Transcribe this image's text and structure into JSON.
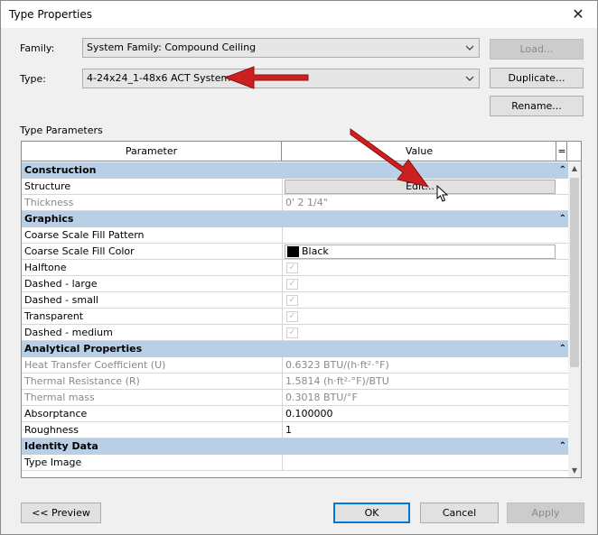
{
  "window": {
    "title": "Type Properties",
    "close": "✕"
  },
  "family": {
    "label": "Family:",
    "value": "System Family: Compound Ceiling",
    "load_button": "Load..."
  },
  "type": {
    "label": "Type:",
    "value": "4-24x24_1-48x6 ACT System",
    "duplicate_button": "Duplicate...",
    "rename_button": "Rename..."
  },
  "type_parameters": {
    "section_label": "Type Parameters",
    "headers": {
      "parameter": "Parameter",
      "value": "Value",
      "sort": "="
    },
    "groups": [
      {
        "name": "Construction",
        "toggle": "⌃",
        "rows": [
          {
            "param": "Structure",
            "value": "Edit...",
            "kind": "button"
          },
          {
            "param": "Thickness",
            "value": "0'  2 1/4\"",
            "kind": "text",
            "disabled": true
          }
        ]
      },
      {
        "name": "Graphics",
        "toggle": "⌃",
        "rows": [
          {
            "param": "Coarse Scale Fill Pattern",
            "value": "",
            "kind": "text"
          },
          {
            "param": "Coarse Scale Fill Color",
            "value": "Black",
            "kind": "color"
          },
          {
            "param": "Halftone",
            "value": "✓",
            "kind": "check"
          },
          {
            "param": "Dashed - large",
            "value": "✓",
            "kind": "check"
          },
          {
            "param": "Dashed - small",
            "value": "✓",
            "kind": "check"
          },
          {
            "param": "Transparent",
            "value": "✓",
            "kind": "check"
          },
          {
            "param": "Dashed - medium",
            "value": "✓",
            "kind": "check"
          }
        ]
      },
      {
        "name": "Analytical Properties",
        "toggle": "⌃",
        "rows": [
          {
            "param": "Heat Transfer Coefficient (U)",
            "value": "0.6323 BTU/(h·ft²·°F)",
            "kind": "text",
            "disabled": true
          },
          {
            "param": "Thermal Resistance (R)",
            "value": "1.5814 (h·ft²·°F)/BTU",
            "kind": "text",
            "disabled": true
          },
          {
            "param": "Thermal mass",
            "value": "0.3018 BTU/°F",
            "kind": "text",
            "disabled": true
          },
          {
            "param": "Absorptance",
            "value": "0.100000",
            "kind": "text"
          },
          {
            "param": "Roughness",
            "value": "1",
            "kind": "text"
          }
        ]
      },
      {
        "name": "Identity Data",
        "toggle": "⌃",
        "rows": [
          {
            "param": "Type Image",
            "value": "",
            "kind": "text"
          }
        ]
      }
    ]
  },
  "footer": {
    "preview_button": "<< Preview",
    "ok_button": "OK",
    "cancel_button": "Cancel",
    "apply_button": "Apply"
  },
  "colors": {
    "group_header": "#b9cfe6",
    "arrow": "#cc1f1f",
    "default_button_border": "#0078d7"
  }
}
